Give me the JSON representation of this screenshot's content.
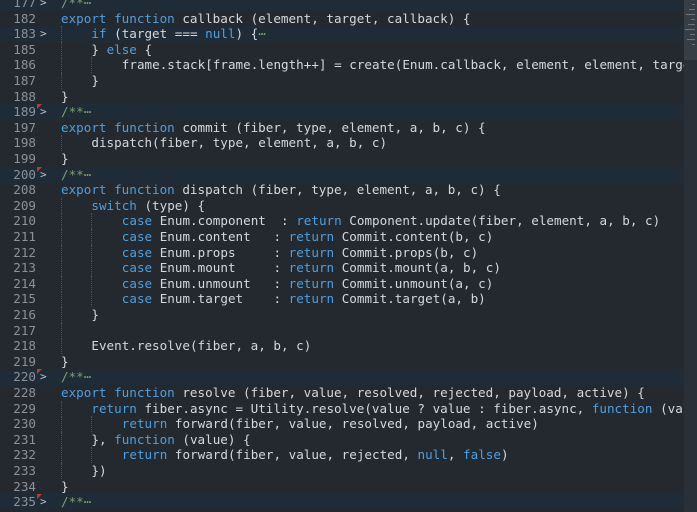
{
  "lines": [
    {
      "n": "177",
      "fold": ">",
      "code": [
        {
          "t": "/**",
          "c": "cm"
        },
        {
          "t": "⋯",
          "c": "cm"
        }
      ],
      "marker": true,
      "hl": true,
      "indent": 0
    },
    {
      "n": "182",
      "fold": "",
      "code": [
        {
          "t": "export function ",
          "c": "kw"
        },
        {
          "t": "callback (element, target, callback) {",
          "c": "fn"
        }
      ],
      "hl": false,
      "indent": 0
    },
    {
      "n": "183",
      "fold": ">",
      "code": [
        {
          "t": "if ",
          "c": "kw"
        },
        {
          "t": "(target === ",
          "c": "fn"
        },
        {
          "t": "null",
          "c": "kw"
        },
        {
          "t": ") {",
          "c": "fn"
        },
        {
          "t": "⋯",
          "c": "cm"
        }
      ],
      "hl": true,
      "indent": 1
    },
    {
      "n": "185",
      "fold": "",
      "code": [
        {
          "t": "} ",
          "c": "fn"
        },
        {
          "t": "else",
          "c": "kw"
        },
        {
          "t": " {",
          "c": "fn"
        }
      ],
      "hl": false,
      "indent": 1
    },
    {
      "n": "186",
      "fold": "",
      "code": [
        {
          "t": "frame.stack[frame.length++] = create(Enum.callback, element, element, target,",
          "c": "fn"
        }
      ],
      "hl": false,
      "indent": 2
    },
    {
      "n": "187",
      "fold": "",
      "code": [
        {
          "t": "}",
          "c": "fn"
        }
      ],
      "hl": false,
      "indent": 1
    },
    {
      "n": "188",
      "fold": "",
      "code": [
        {
          "t": "}",
          "c": "fn"
        }
      ],
      "hl": false,
      "indent": 0
    },
    {
      "n": "189",
      "fold": ">",
      "code": [
        {
          "t": "/**",
          "c": "cm"
        },
        {
          "t": "⋯",
          "c": "cm"
        }
      ],
      "marker": true,
      "hl": true,
      "indent": 0
    },
    {
      "n": "197",
      "fold": "",
      "code": [
        {
          "t": "export function ",
          "c": "kw"
        },
        {
          "t": "commit (fiber, type, element, a, b, c) {",
          "c": "fn"
        }
      ],
      "hl": false,
      "indent": 0
    },
    {
      "n": "198",
      "fold": "",
      "code": [
        {
          "t": "dispatch(fiber, type, element, a, b, c)",
          "c": "fn"
        }
      ],
      "hl": false,
      "indent": 1
    },
    {
      "n": "199",
      "fold": "",
      "code": [
        {
          "t": "}",
          "c": "fn"
        }
      ],
      "hl": false,
      "indent": 0
    },
    {
      "n": "200",
      "fold": ">",
      "code": [
        {
          "t": "/**",
          "c": "cm"
        },
        {
          "t": "⋯",
          "c": "cm"
        }
      ],
      "marker": true,
      "hl": true,
      "indent": 0
    },
    {
      "n": "208",
      "fold": "",
      "code": [
        {
          "t": "export function ",
          "c": "kw"
        },
        {
          "t": "dispatch (fiber, type, element, a, b, c) {",
          "c": "fn"
        }
      ],
      "hl": false,
      "indent": 0
    },
    {
      "n": "209",
      "fold": "",
      "code": [
        {
          "t": "switch",
          "c": "kw"
        },
        {
          "t": " (type) {",
          "c": "fn"
        }
      ],
      "hl": false,
      "indent": 1
    },
    {
      "n": "210",
      "fold": "",
      "code": [
        {
          "t": "case ",
          "c": "kw"
        },
        {
          "t": "Enum.component  : ",
          "c": "fn"
        },
        {
          "t": "return ",
          "c": "kw"
        },
        {
          "t": "Component.update(fiber, element, a, b, c)",
          "c": "fn"
        }
      ],
      "hl": false,
      "indent": 2
    },
    {
      "n": "211",
      "fold": "",
      "code": [
        {
          "t": "case ",
          "c": "kw"
        },
        {
          "t": "Enum.content   : ",
          "c": "fn"
        },
        {
          "t": "return ",
          "c": "kw"
        },
        {
          "t": "Commit.content(b, c)",
          "c": "fn"
        }
      ],
      "hl": false,
      "indent": 2
    },
    {
      "n": "212",
      "fold": "",
      "code": [
        {
          "t": "case ",
          "c": "kw"
        },
        {
          "t": "Enum.props     : ",
          "c": "fn"
        },
        {
          "t": "return ",
          "c": "kw"
        },
        {
          "t": "Commit.props(b, c)",
          "c": "fn"
        }
      ],
      "hl": false,
      "indent": 2
    },
    {
      "n": "213",
      "fold": "",
      "code": [
        {
          "t": "case ",
          "c": "kw"
        },
        {
          "t": "Enum.mount     : ",
          "c": "fn"
        },
        {
          "t": "return ",
          "c": "kw"
        },
        {
          "t": "Commit.mount(a, b, c)",
          "c": "fn"
        }
      ],
      "hl": false,
      "indent": 2
    },
    {
      "n": "214",
      "fold": "",
      "code": [
        {
          "t": "case ",
          "c": "kw"
        },
        {
          "t": "Enum.unmount   : ",
          "c": "fn"
        },
        {
          "t": "return ",
          "c": "kw"
        },
        {
          "t": "Commit.unmount(a, c)",
          "c": "fn"
        }
      ],
      "hl": false,
      "indent": 2
    },
    {
      "n": "215",
      "fold": "",
      "code": [
        {
          "t": "case ",
          "c": "kw"
        },
        {
          "t": "Enum.target    : ",
          "c": "fn"
        },
        {
          "t": "return ",
          "c": "kw"
        },
        {
          "t": "Commit.target(a, b)",
          "c": "fn"
        }
      ],
      "hl": false,
      "indent": 2
    },
    {
      "n": "216",
      "fold": "",
      "code": [
        {
          "t": "}",
          "c": "fn"
        }
      ],
      "hl": false,
      "indent": 1
    },
    {
      "n": "217",
      "fold": "",
      "code": [],
      "hl": false,
      "indent": 1
    },
    {
      "n": "218",
      "fold": "",
      "code": [
        {
          "t": "Event.resolve(fiber, a, b, c)",
          "c": "fn"
        }
      ],
      "hl": false,
      "indent": 1
    },
    {
      "n": "219",
      "fold": "",
      "code": [
        {
          "t": "}",
          "c": "fn"
        }
      ],
      "hl": false,
      "indent": 0
    },
    {
      "n": "220",
      "fold": ">",
      "code": [
        {
          "t": "/**",
          "c": "cm"
        },
        {
          "t": "⋯",
          "c": "cm"
        }
      ],
      "marker": true,
      "hl": true,
      "indent": 0
    },
    {
      "n": "228",
      "fold": "",
      "code": [
        {
          "t": "export function ",
          "c": "kw"
        },
        {
          "t": "resolve (fiber, value, resolved, rejected, payload, active) {",
          "c": "fn"
        }
      ],
      "hl": false,
      "indent": 0
    },
    {
      "n": "229",
      "fold": "",
      "code": [
        {
          "t": "return ",
          "c": "kw"
        },
        {
          "t": "fiber.async = Utility.resolve(value ? value : fiber.async, ",
          "c": "fn"
        },
        {
          "t": "function",
          "c": "kw"
        },
        {
          "t": " (value",
          "c": "fn"
        }
      ],
      "hl": false,
      "indent": 1
    },
    {
      "n": "230",
      "fold": "",
      "code": [
        {
          "t": "return ",
          "c": "kw"
        },
        {
          "t": "forward(fiber, value, resolved, payload, active)",
          "c": "fn"
        }
      ],
      "hl": false,
      "indent": 2
    },
    {
      "n": "231",
      "fold": "",
      "code": [
        {
          "t": "}, ",
          "c": "fn"
        },
        {
          "t": "function",
          "c": "kw"
        },
        {
          "t": " (value) {",
          "c": "fn"
        }
      ],
      "hl": false,
      "indent": 1
    },
    {
      "n": "232",
      "fold": "",
      "code": [
        {
          "t": "return ",
          "c": "kw"
        },
        {
          "t": "forward(fiber, value, rejected, ",
          "c": "fn"
        },
        {
          "t": "null",
          "c": "kw"
        },
        {
          "t": ", ",
          "c": "fn"
        },
        {
          "t": "false",
          "c": "kw"
        },
        {
          "t": ")",
          "c": "fn"
        }
      ],
      "hl": false,
      "indent": 2
    },
    {
      "n": "233",
      "fold": "",
      "code": [
        {
          "t": "})",
          "c": "fn"
        }
      ],
      "hl": false,
      "indent": 1
    },
    {
      "n": "234",
      "fold": "",
      "code": [
        {
          "t": "}",
          "c": "fn"
        }
      ],
      "hl": false,
      "indent": 0
    },
    {
      "n": "235",
      "fold": ">",
      "code": [
        {
          "t": "/**",
          "c": "cm"
        },
        {
          "t": "⋯",
          "c": "cm"
        }
      ],
      "marker": true,
      "hl": true,
      "indent": 0
    }
  ],
  "colors": {
    "keyword": "#4d9fe0",
    "comment": "#7aa06a",
    "text": "#d4d8dc",
    "line_number": "#8a9199",
    "breakpoint": "#c0392b"
  },
  "icons": {
    "fold": "chevron-right-icon",
    "marker": "breakpoint-marker-icon"
  }
}
